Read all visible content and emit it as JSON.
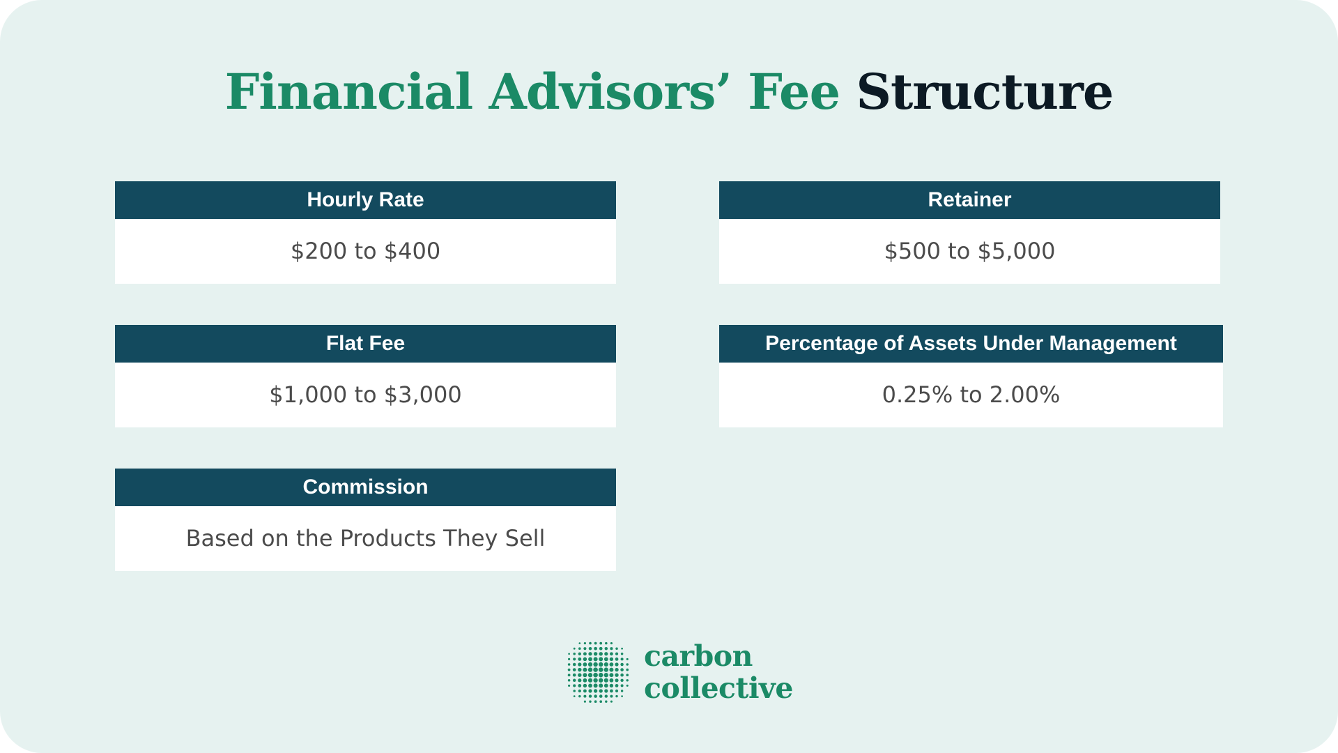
{
  "title": {
    "part1": "Financial Advisors’ Fee",
    "part2": "Structure"
  },
  "colors": {
    "background": "#e6f2f0",
    "accent_green": "#1b8a66",
    "header_teal": "#134a5e",
    "title_dark": "#0c1a24"
  },
  "fees": [
    {
      "label": "Hourly Rate",
      "value": "$200 to $400"
    },
    {
      "label": "Retainer",
      "value": "$500 to $5,000"
    },
    {
      "label": "Flat Fee",
      "value": "$1,000 to $3,000"
    },
    {
      "label": "Percentage of Assets Under Management",
      "value": "0.25% to 2.00%"
    },
    {
      "label": "Commission",
      "value": "Based on the Products They Sell"
    }
  ],
  "logo": {
    "line1": "carbon",
    "line2": "collective",
    "icon": "dotted-sphere-icon"
  }
}
